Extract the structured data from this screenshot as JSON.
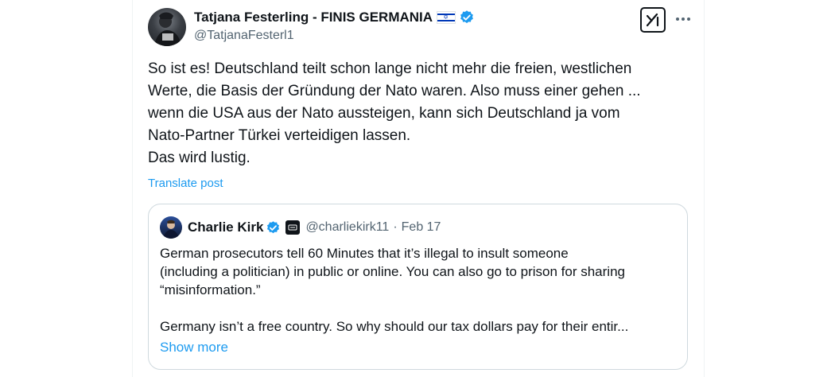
{
  "post": {
    "author": {
      "display_name": "Tatjana Festerling - FINIS GERMANIA",
      "flag": "🇮🇱",
      "handle": "@TatjanaFesterl1",
      "verified": true
    },
    "text_lines": [
      "So ist es! Deutschland teilt schon lange nicht mehr die freien, westlichen",
      "Werte, die Basis der Gründung der Nato waren. Also muss einer gehen ...",
      "wenn die USA aus der Nato aussteigen, kann sich Deutschland ja vom",
      "Nato-Partner Türkei verteidigen lassen.",
      "Das wird lustig."
    ],
    "translate_label": "Translate post",
    "icons": {
      "grok": "grok-icon",
      "more": "more-icon",
      "verified": "verified-badge-icon"
    }
  },
  "quote": {
    "author": {
      "display_name": "Charlie Kirk",
      "handle": "@charliekirk11",
      "separator": "·",
      "date": "Feb 17",
      "verified": true
    },
    "text_lines": [
      "German prosecutors tell 60 Minutes that it’s illegal to insult someone",
      "(including a politician) in public or online. You can also go to prison for sharing",
      "“misinformation.”",
      "",
      "Germany isn’t a free country. So why should our tax dollars pay for their entir..."
    ],
    "show_more_label": "Show more"
  },
  "colors": {
    "accent": "#1d9bf0",
    "text": "#0f1419",
    "secondary": "#536471",
    "border": "#cfd9de"
  }
}
